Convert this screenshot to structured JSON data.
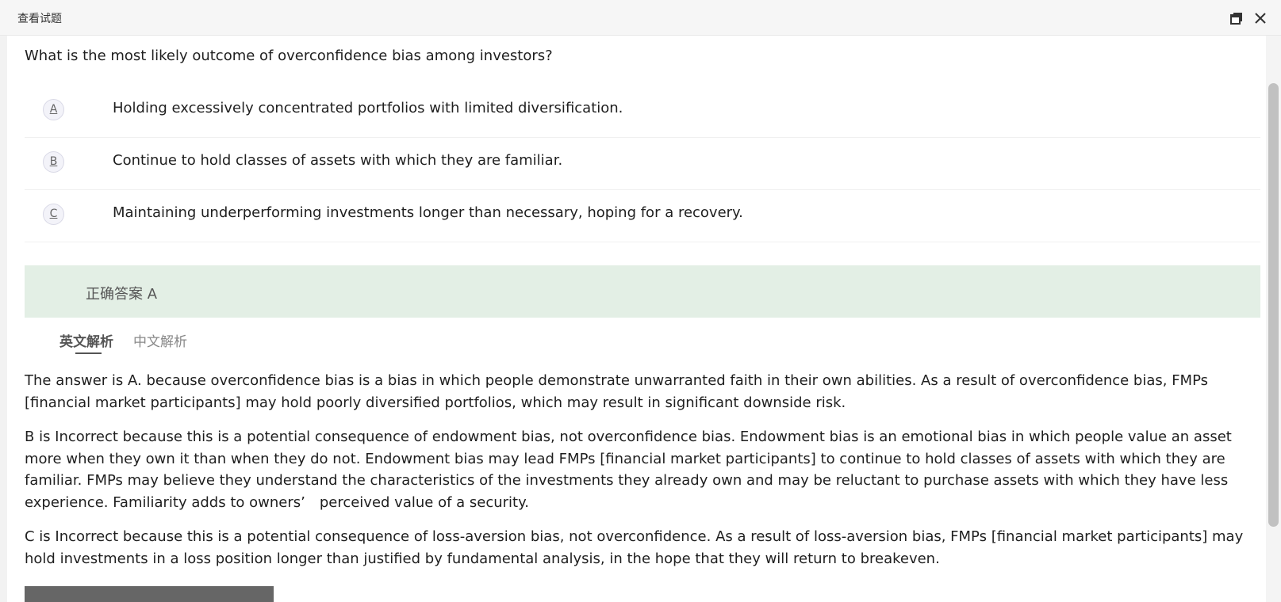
{
  "window": {
    "title": "查看试题",
    "restore_icon": "restore-window-icon",
    "close_icon": "close-icon"
  },
  "question": {
    "text": "What is the most likely outcome of overconfidence bias among investors?",
    "options": [
      {
        "letter": "A",
        "text": "Holding excessively concentrated portfolios with limited diversification."
      },
      {
        "letter": "B",
        "text": "Continue to hold classes of assets with which they are familiar."
      },
      {
        "letter": "C",
        "text": "Maintaining underperforming investments longer than necessary, hoping for a recovery."
      }
    ]
  },
  "answer": {
    "label": "正确答案 A",
    "bar_color": "#e3efe5"
  },
  "tabs": [
    {
      "label": "英文解析",
      "active": true
    },
    {
      "label": "中文解析",
      "active": false
    }
  ],
  "explanation": {
    "paragraphs": [
      "The answer is A. because overconfidence bias is a bias in which people demonstrate unwarranted faith in their own abilities. As a result of overconfidence bias, FMPs [financial market participants] may hold poorly diversified portfolios, which may result in significant downside risk.",
      "B is Incorrect because this is a potential consequence of endowment bias, not overconfidence bias. Endowment bias is an emotional bias in which people value an asset more when they own it than when they do not. Endowment bias may lead FMPs [financial market participants] to continue to hold classes of assets with which they are familiar. FMPs may believe they understand the characteristics of the investments they already own and may be reluctant to purchase assets with which they have less experience. Familiarity adds to owners’　perceived value of a security.",
      "C is Incorrect because this is a potential consequence of loss-aversion bias, not overconfidence. As a result of loss-aversion bias, FMPs [financial market participants] may hold investments in a loss position longer than justified by fundamental analysis, in the hope that they will return to breakeven."
    ]
  }
}
